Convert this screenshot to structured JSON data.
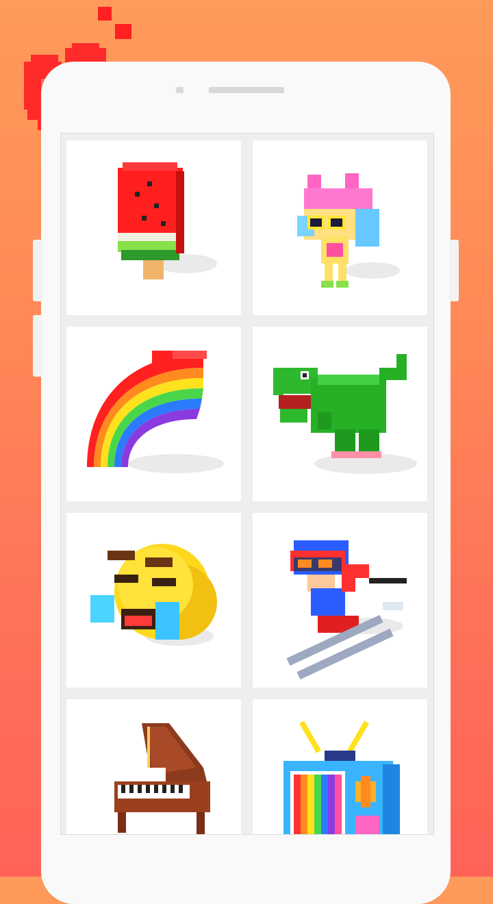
{
  "app": {
    "screen": "voxel-gallery"
  },
  "colors": {
    "background_top": "#ff9a5a",
    "background_bottom": "#ff6358",
    "phone": "#f9f9f9",
    "card": "#ffffff"
  },
  "gallery": {
    "items": [
      {
        "name": "watermelon-popsicle"
      },
      {
        "name": "girl-with-sunglasses"
      },
      {
        "name": "rainbow"
      },
      {
        "name": "green-dinosaur"
      },
      {
        "name": "laughing-crying-emoji"
      },
      {
        "name": "skier"
      },
      {
        "name": "piano"
      },
      {
        "name": "retro-tv"
      }
    ]
  },
  "decorations": {
    "heart": "pixel-heart-icon"
  }
}
